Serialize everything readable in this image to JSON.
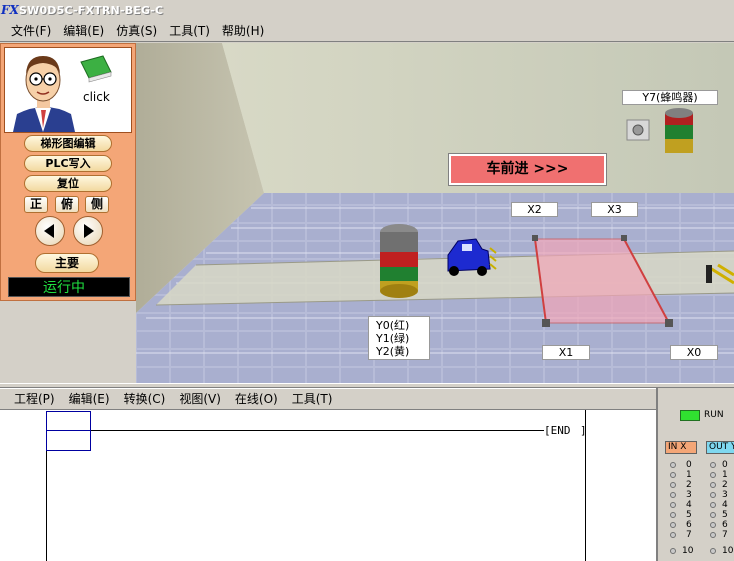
{
  "window": {
    "title": "SW0D5C-FXTRN-BEG-C",
    "icon": "FX"
  },
  "top_menu": [
    {
      "label": "文件(F)"
    },
    {
      "label": "编辑(E)"
    },
    {
      "label": "仿真(S)"
    },
    {
      "label": "工具(T)"
    },
    {
      "label": "帮助(H)"
    }
  ],
  "panel": {
    "click_label": "click",
    "buttons": {
      "ladder_edit": "梯形图编辑",
      "plc_write": "PLC写入",
      "reset": "复位"
    },
    "views": {
      "front": "正",
      "top": "俯",
      "side": "侧"
    },
    "main_button": "主要",
    "status": "运行中"
  },
  "scene": {
    "banner": "车前进 >>>",
    "labels": {
      "y7": "Y7(蜂鸣器)",
      "x2": "X2",
      "x3": "X3",
      "x1": "X1",
      "x0": "X0",
      "signal_y0": "Y0(红)",
      "signal_y1": "Y1(绿)",
      "signal_y2": "Y2(黄)"
    }
  },
  "editor_menu": [
    {
      "label": "工程(P)"
    },
    {
      "label": "编辑(E)"
    },
    {
      "label": "转换(C)"
    },
    {
      "label": "视图(V)"
    },
    {
      "label": "在线(O)"
    },
    {
      "label": "工具(T)"
    }
  ],
  "ladder": {
    "end_label": "[END",
    "end_bracket": "]"
  },
  "io_panel": {
    "run_label": "RUN",
    "in_header": "IN X",
    "out_header": "OUT Y",
    "in_numbers": [
      "0",
      "1",
      "2",
      "3",
      "4",
      "5",
      "6",
      "7",
      "10"
    ],
    "out_numbers": [
      "0",
      "1",
      "2",
      "3",
      "4",
      "5",
      "6",
      "7",
      "10"
    ]
  },
  "colors": {
    "panel_bg": "#f4a677",
    "banner": "#f07070",
    "status_text": "#20e040",
    "run_led": "#30e030"
  }
}
